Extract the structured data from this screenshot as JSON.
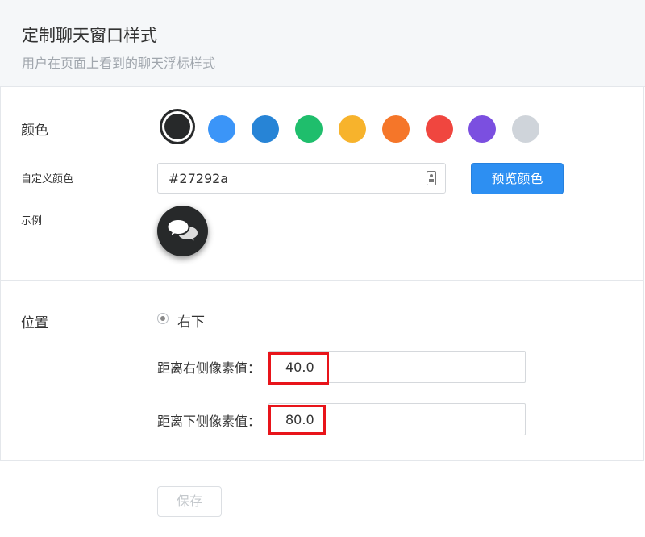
{
  "header": {
    "title": "定制聊天窗口样式",
    "subtitle": "用户在页面上看到的聊天浮标样式"
  },
  "color_section": {
    "label": "颜色",
    "swatches": [
      {
        "name": "dark",
        "color": "#27292a",
        "selected": true
      },
      {
        "name": "blue",
        "color": "#3b95f8",
        "selected": false
      },
      {
        "name": "darkblue",
        "color": "#2784d6",
        "selected": false
      },
      {
        "name": "green",
        "color": "#1fbe6c",
        "selected": false
      },
      {
        "name": "yellow",
        "color": "#f7b32c",
        "selected": false
      },
      {
        "name": "orange",
        "color": "#f57629",
        "selected": false
      },
      {
        "name": "red",
        "color": "#f0463f",
        "selected": false
      },
      {
        "name": "purple",
        "color": "#7b4fe0",
        "selected": false
      },
      {
        "name": "gray",
        "color": "#cfd4da",
        "selected": false
      }
    ],
    "custom_label": "自定义颜色",
    "custom_value": "#27292a",
    "picker_icon": "color-picker-icon",
    "preview_button": "预览颜色",
    "example_label": "示例",
    "example_icon": "chat-bubbles-icon"
  },
  "position_section": {
    "label": "位置",
    "radio_option": "右下",
    "radio_selected": true,
    "right_offset_label": "距离右侧像素值：",
    "right_offset_value": "40.0",
    "bottom_offset_label": "距离下侧像素值：",
    "bottom_offset_value": "80.0"
  },
  "actions": {
    "save_button": "保存"
  },
  "colors": {
    "accent": "#2d8ff2",
    "highlight": "#e8141a"
  }
}
